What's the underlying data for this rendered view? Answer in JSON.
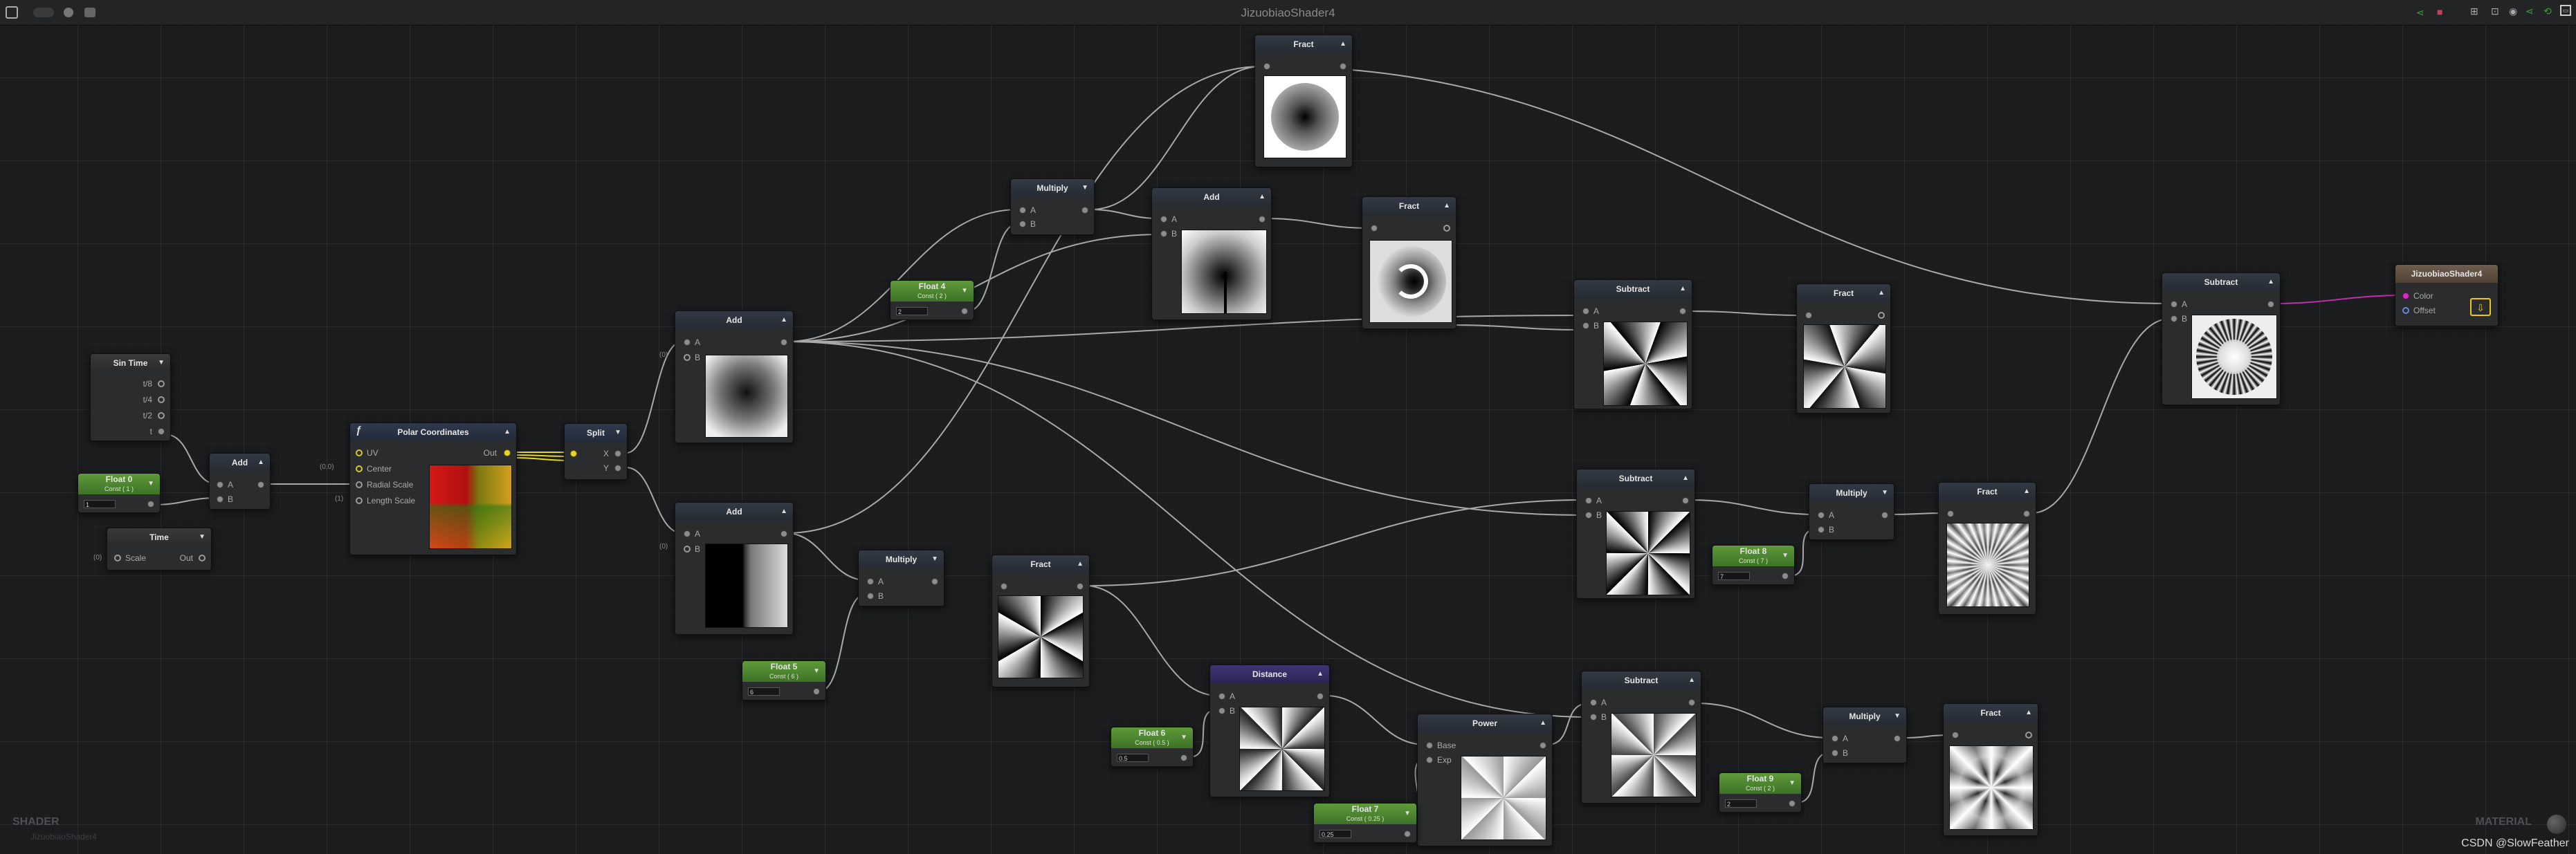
{
  "window": {
    "title": "JizuobiaoShader4"
  },
  "toolbar": {
    "left_icons": [
      "panel-toggle-icon",
      "toggle-icon",
      "circle-icon",
      "image-icon"
    ],
    "right_icons": [
      "share-icon",
      "camera-icon",
      "layout-icon",
      "save-icon",
      "recenter-icon",
      "settings-icon",
      "minimize-icon"
    ]
  },
  "corner_left": {
    "label": "SHADER",
    "name": "JizuobiaoShader4"
  },
  "corner_right": {
    "label": "MATERIAL"
  },
  "watermark": "CSDN @SlowFeather",
  "nodes": {
    "sintime": {
      "title": "Sin Time",
      "ports": [
        "t/8",
        "t/4",
        "t/2",
        "t"
      ]
    },
    "float0": {
      "title": "Float 0",
      "sub": "Const ( 1 )",
      "value": "1"
    },
    "time": {
      "title": "Time",
      "in": "Scale",
      "out": "Out",
      "side": "(0)"
    },
    "add1": {
      "title": "Add",
      "a": "A",
      "b": "B"
    },
    "polar": {
      "title": "Polar Coordinates",
      "inputs": [
        "UV",
        "Center",
        "Radial Scale",
        "Length Scale"
      ],
      "out": "Out",
      "side1": "(0,0)",
      "side2": "(1)"
    },
    "split": {
      "title": "Split",
      "x": "X",
      "y": "Y"
    },
    "add2": {
      "title": "Add",
      "a": "A",
      "b": "B",
      "side": "(0)"
    },
    "add3": {
      "title": "Add",
      "a": "A",
      "b": "B",
      "side": "(0)"
    },
    "float4": {
      "title": "Float 4",
      "sub": "Const ( 2 )",
      "value": "2"
    },
    "float5": {
      "title": "Float 5",
      "sub": "Const ( 6 )",
      "value": "6"
    },
    "float6": {
      "title": "Float 6",
      "sub": "Const ( 0.5 )",
      "value": "0.5"
    },
    "float7": {
      "title": "Float 7",
      "sub": "Const ( 0.25 )",
      "value": "0.25"
    },
    "float8": {
      "title": "Float 8",
      "sub": "Const ( 7 )",
      "value": "7"
    },
    "float9": {
      "title": "Float 9",
      "sub": "Const ( 2 )",
      "value": "2"
    },
    "mul1": {
      "title": "Multiply",
      "a": "A",
      "b": "B"
    },
    "mul2": {
      "title": "Multiply",
      "a": "A",
      "b": "B"
    },
    "mul3": {
      "title": "Multiply",
      "a": "A",
      "b": "B"
    },
    "mul4": {
      "title": "Multiply",
      "a": "A",
      "b": "B"
    },
    "add4": {
      "title": "Add",
      "a": "A",
      "b": "B"
    },
    "fract1": {
      "title": "Fract"
    },
    "fract2": {
      "title": "Fract"
    },
    "fract3": {
      "title": "Fract"
    },
    "fract4": {
      "title": "Fract"
    },
    "fract5": {
      "title": "Fract"
    },
    "fract6": {
      "title": "Fract"
    },
    "sub1": {
      "title": "Subtract",
      "a": "A",
      "b": "B"
    },
    "sub2": {
      "title": "Subtract",
      "a": "A",
      "b": "B"
    },
    "sub3": {
      "title": "Subtract",
      "a": "A",
      "b": "B"
    },
    "sub4": {
      "title": "Subtract",
      "a": "A",
      "b": "B"
    },
    "distance": {
      "title": "Distance",
      "a": "A",
      "b": "B"
    },
    "power": {
      "title": "Power",
      "base": "Base",
      "exp": "Exp"
    },
    "master": {
      "title": "JizuobiaoShader4",
      "color": "Color",
      "offset": "Offset"
    }
  },
  "colors": {
    "float_header": "#4f8a30",
    "distance_header": "#342e66",
    "master_header": "#64543f",
    "uv_port": "#e8d52a",
    "color_port": "#d42dbd"
  }
}
